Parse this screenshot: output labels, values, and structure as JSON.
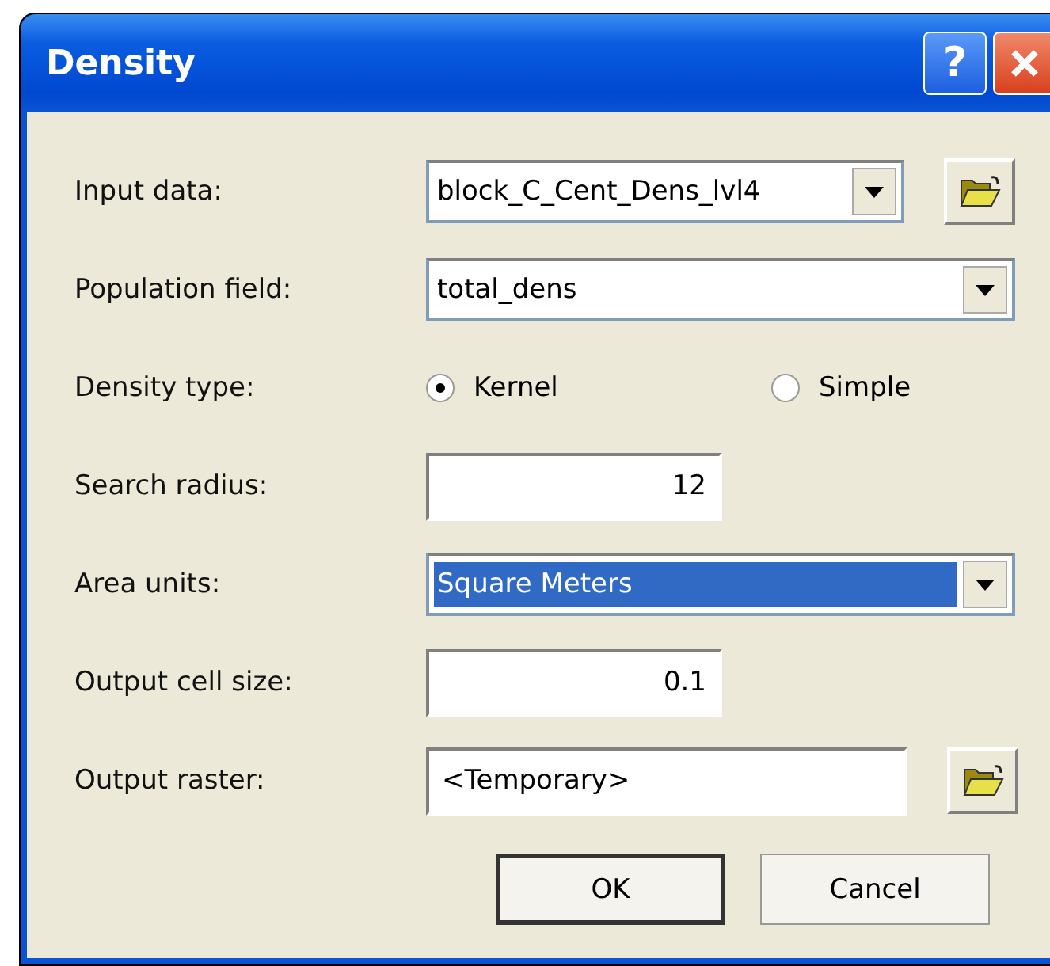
{
  "window": {
    "title": "Density",
    "help_button": "?"
  },
  "fields": [
    {
      "kind": "combo",
      "label": "Input data:",
      "value": "block_C_Cent_Dens_lvl4",
      "browse": true,
      "highlighted": false
    },
    {
      "kind": "combo",
      "label": "Population field:",
      "value": "total_dens",
      "browse": false,
      "highlighted": false
    },
    {
      "kind": "radio",
      "label": "Density type:",
      "options": [
        {
          "label": "Kernel",
          "selected": true
        },
        {
          "label": "Simple",
          "selected": false
        }
      ]
    },
    {
      "kind": "text",
      "label": "Search radius:",
      "value": "12",
      "browse": false
    },
    {
      "kind": "combo",
      "label": "Area units:",
      "value": "Square Meters",
      "browse": false,
      "highlighted": true
    },
    {
      "kind": "text",
      "label": "Output cell size:",
      "value": "0.1",
      "browse": false
    },
    {
      "kind": "wide_text",
      "label": "Output raster:",
      "value": "<Temporary>",
      "browse": true
    }
  ],
  "buttons": [
    {
      "label": "OK",
      "default": true
    },
    {
      "label": "Cancel",
      "default": false
    }
  ]
}
